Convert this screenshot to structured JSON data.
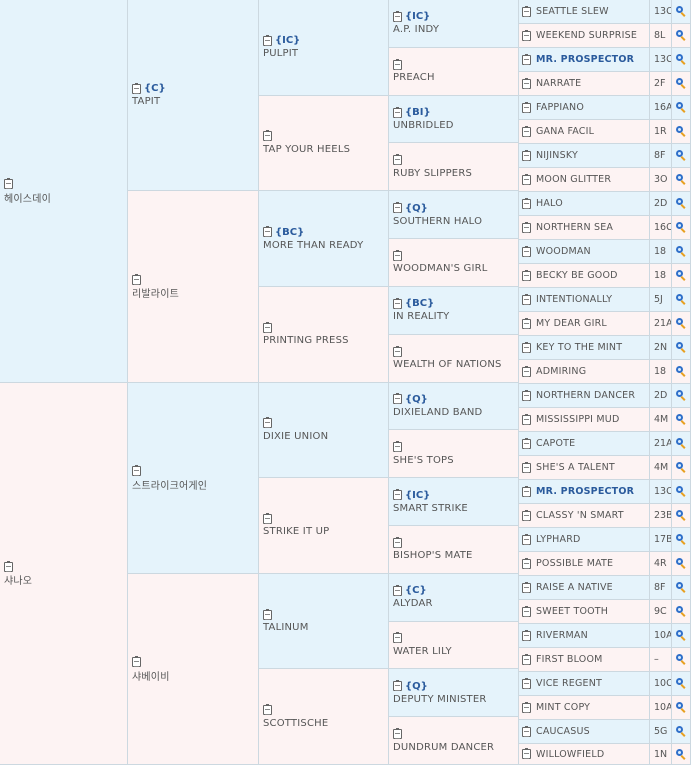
{
  "g1": [
    {
      "name": "헤이스데이",
      "tag": ""
    },
    {
      "name": "샤나오",
      "tag": ""
    }
  ],
  "g2": [
    {
      "name": "TAPIT",
      "tag": "{C}"
    },
    {
      "name": "리발라이트",
      "tag": ""
    },
    {
      "name": "스트라이크어게인",
      "tag": ""
    },
    {
      "name": "샤베이비",
      "tag": ""
    }
  ],
  "g3": [
    {
      "name": "PULPIT",
      "tag": "{IC}"
    },
    {
      "name": "TAP YOUR HEELS",
      "tag": ""
    },
    {
      "name": "MORE THAN READY",
      "tag": "{BC}"
    },
    {
      "name": "PRINTING PRESS",
      "tag": ""
    },
    {
      "name": "DIXIE UNION",
      "tag": ""
    },
    {
      "name": "STRIKE IT UP",
      "tag": ""
    },
    {
      "name": "TALINUM",
      "tag": ""
    },
    {
      "name": "SCOTTISCHE",
      "tag": ""
    }
  ],
  "g4": [
    {
      "name": "A.P. INDY",
      "tag": "{IC}"
    },
    {
      "name": "PREACH",
      "tag": ""
    },
    {
      "name": "UNBRIDLED",
      "tag": "{BI}"
    },
    {
      "name": "RUBY SLIPPERS",
      "tag": ""
    },
    {
      "name": "SOUTHERN HALO",
      "tag": "{Q}"
    },
    {
      "name": "WOODMAN'S GIRL",
      "tag": ""
    },
    {
      "name": "IN REALITY",
      "tag": "{BC}"
    },
    {
      "name": "WEALTH OF NATIONS",
      "tag": ""
    },
    {
      "name": "DIXIELAND BAND",
      "tag": "{Q}"
    },
    {
      "name": "SHE'S TOPS",
      "tag": ""
    },
    {
      "name": "SMART STRIKE",
      "tag": "{IC}"
    },
    {
      "name": "BISHOP'S MATE",
      "tag": ""
    },
    {
      "name": "ALYDAR",
      "tag": "{C}"
    },
    {
      "name": "WATER LILY",
      "tag": ""
    },
    {
      "name": "DEPUTY MINISTER",
      "tag": "{Q}"
    },
    {
      "name": "DUNDRUM DANCER",
      "tag": ""
    }
  ],
  "g5": [
    {
      "name": "SEATTLE SLEW",
      "num": "13C",
      "bold": false
    },
    {
      "name": "WEEKEND SURPRISE",
      "num": "8L",
      "bold": false
    },
    {
      "name": "MR. PROSPECTOR",
      "num": "13C",
      "bold": true
    },
    {
      "name": "NARRATE",
      "num": "2F",
      "bold": false
    },
    {
      "name": "FAPPIANO",
      "num": "16A",
      "bold": false
    },
    {
      "name": "GANA FACIL",
      "num": "1R",
      "bold": false
    },
    {
      "name": "NIJINSKY",
      "num": "8F",
      "bold": false
    },
    {
      "name": "MOON GLITTER",
      "num": "3O",
      "bold": false
    },
    {
      "name": "HALO",
      "num": "2D",
      "bold": false
    },
    {
      "name": "NORTHERN SEA",
      "num": "16C",
      "bold": false
    },
    {
      "name": "WOODMAN",
      "num": "18",
      "bold": false
    },
    {
      "name": "BECKY BE GOOD",
      "num": "18",
      "bold": false
    },
    {
      "name": "INTENTIONALLY",
      "num": "5J",
      "bold": false
    },
    {
      "name": "MY DEAR GIRL",
      "num": "21A",
      "bold": false
    },
    {
      "name": "KEY TO THE MINT",
      "num": "2N",
      "bold": false
    },
    {
      "name": "ADMIRING",
      "num": "18",
      "bold": false
    },
    {
      "name": "NORTHERN DANCER",
      "num": "2D",
      "bold": false
    },
    {
      "name": "MISSISSIPPI MUD",
      "num": "4M",
      "bold": false
    },
    {
      "name": "CAPOTE",
      "num": "21A",
      "bold": false
    },
    {
      "name": "SHE'S A TALENT",
      "num": "4M",
      "bold": false
    },
    {
      "name": "MR. PROSPECTOR",
      "num": "13C",
      "bold": true
    },
    {
      "name": "CLASSY 'N SMART",
      "num": "23B",
      "bold": false
    },
    {
      "name": "LYPHARD",
      "num": "17B",
      "bold": false
    },
    {
      "name": "POSSIBLE MATE",
      "num": "4R",
      "bold": false
    },
    {
      "name": "RAISE A NATIVE",
      "num": "8F",
      "bold": false
    },
    {
      "name": "SWEET TOOTH",
      "num": "9C",
      "bold": false
    },
    {
      "name": "RIVERMAN",
      "num": "10A",
      "bold": false
    },
    {
      "name": "FIRST BLOOM",
      "num": "–",
      "bold": false
    },
    {
      "name": "VICE REGENT",
      "num": "10C",
      "bold": false
    },
    {
      "name": "MINT COPY",
      "num": "10A",
      "bold": false
    },
    {
      "name": "CAUCASUS",
      "num": "5G",
      "bold": false
    },
    {
      "name": "WILLOWFIELD",
      "num": "1N",
      "bold": false
    }
  ]
}
